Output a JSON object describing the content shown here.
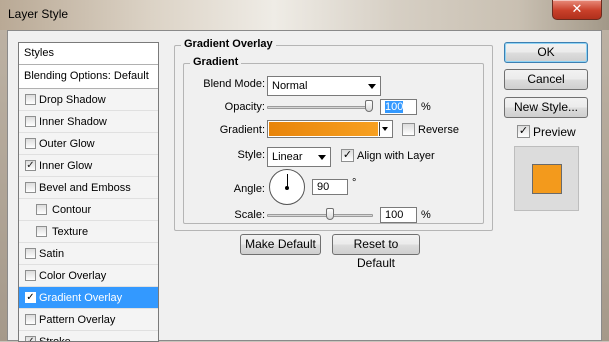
{
  "window": {
    "title": "Layer Style",
    "close_glyph": "✕"
  },
  "styles_list": {
    "header": "Styles",
    "blending_options": "Blending Options: Default",
    "items": [
      {
        "label": "Drop Shadow",
        "checked": false,
        "selected": false,
        "indent": false
      },
      {
        "label": "Inner Shadow",
        "checked": false,
        "selected": false,
        "indent": false
      },
      {
        "label": "Outer Glow",
        "checked": false,
        "selected": false,
        "indent": false
      },
      {
        "label": "Inner Glow",
        "checked": true,
        "selected": false,
        "indent": false
      },
      {
        "label": "Bevel and Emboss",
        "checked": false,
        "selected": false,
        "indent": false
      },
      {
        "label": "Contour",
        "checked": false,
        "selected": false,
        "indent": true
      },
      {
        "label": "Texture",
        "checked": false,
        "selected": false,
        "indent": true
      },
      {
        "label": "Satin",
        "checked": false,
        "selected": false,
        "indent": false
      },
      {
        "label": "Color Overlay",
        "checked": false,
        "selected": false,
        "indent": false
      },
      {
        "label": "Gradient Overlay",
        "checked": true,
        "selected": true,
        "indent": false
      },
      {
        "label": "Pattern Overlay",
        "checked": false,
        "selected": false,
        "indent": false
      },
      {
        "label": "Stroke",
        "checked": true,
        "selected": false,
        "indent": false
      }
    ]
  },
  "gradient_overlay": {
    "group_title": "Gradient Overlay",
    "subgroup_title": "Gradient",
    "blend_mode_label": "Blend Mode:",
    "blend_mode_value": "Normal",
    "opacity_label": "Opacity:",
    "opacity_value": "100",
    "opacity_unit": "%",
    "opacity_fraction": 1.0,
    "gradient_label": "Gradient:",
    "gradient_colors": [
      "#e8840a",
      "#f7a021"
    ],
    "reverse_label": "Reverse",
    "reverse_checked": false,
    "style_label": "Style:",
    "style_value": "Linear",
    "align_label": "Align with Layer",
    "align_checked": true,
    "angle_label": "Angle:",
    "angle_value": "90",
    "angle_unit": "°",
    "scale_label": "Scale:",
    "scale_value": "100",
    "scale_unit": "%",
    "scale_fraction": 0.6,
    "make_default_label": "Make Default",
    "reset_default_label": "Reset to Default"
  },
  "actions": {
    "ok_label": "OK",
    "cancel_label": "Cancel",
    "new_style_label": "New Style...",
    "preview_label": "Preview",
    "preview_checked": true,
    "preview_color": "#f39a1c",
    "check_glyph": "✓"
  }
}
